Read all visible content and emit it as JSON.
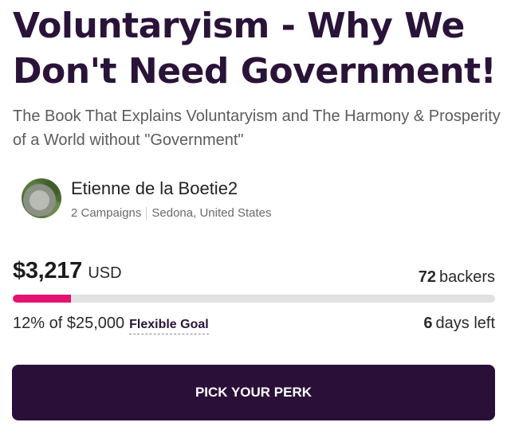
{
  "campaign": {
    "title": "Voluntaryism - Why We Don't Need Government!",
    "subtitle": "The Book That Explains Voluntaryism and The Harmony & Prosperity of a World without \"Government\""
  },
  "owner": {
    "name": "Etienne de la Boetie2",
    "campaigns": "2 Campaigns",
    "location": "Sedona, United States"
  },
  "funding": {
    "amount": "$3,217",
    "currency": "USD",
    "backers_count": "72",
    "backers_label": "backers",
    "progress_percent": 12,
    "progress_text": "12% of $25,000",
    "goal_type": "Flexible Goal",
    "days_count": "6",
    "days_label": "days left"
  },
  "cta": {
    "label": "PICK YOUR PERK"
  },
  "colors": {
    "title": "#2a1338",
    "progress": "#e5126f",
    "cta_bg": "#2a0f38"
  }
}
